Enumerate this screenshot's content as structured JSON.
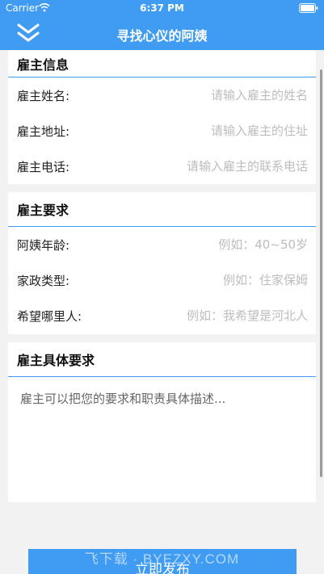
{
  "status_bar": {
    "carrier": "Carrier",
    "time": "6:37 PM"
  },
  "nav": {
    "title": "寻找心仪的阿姨"
  },
  "employer_info": {
    "header": "雇主信息",
    "fields": [
      {
        "label": "雇主姓名:",
        "placeholder": "请输入雇主的姓名"
      },
      {
        "label": "雇主地址:",
        "placeholder": "请输入雇主的住址"
      },
      {
        "label": "雇主电话:",
        "placeholder": "请输入雇主的联系电话"
      }
    ]
  },
  "employer_requirements": {
    "header": "雇主要求",
    "fields": [
      {
        "label": "阿姨年龄:",
        "placeholder": "例如：40~50岁"
      },
      {
        "label": "家政类型:",
        "placeholder": "例如：住家保姆"
      },
      {
        "label": "希望哪里人:",
        "placeholder": "例如：我希望是河北人"
      }
    ]
  },
  "specific_requirements": {
    "header": "雇主具体要求",
    "placeholder": "雇主可以把您的要求和职责具体描述..."
  },
  "submit_label": "立即发布",
  "watermark": "飞下载 · BYEZXY.COM",
  "colors": {
    "accent": "#3f9cf2",
    "background": "#f2f2f2"
  }
}
